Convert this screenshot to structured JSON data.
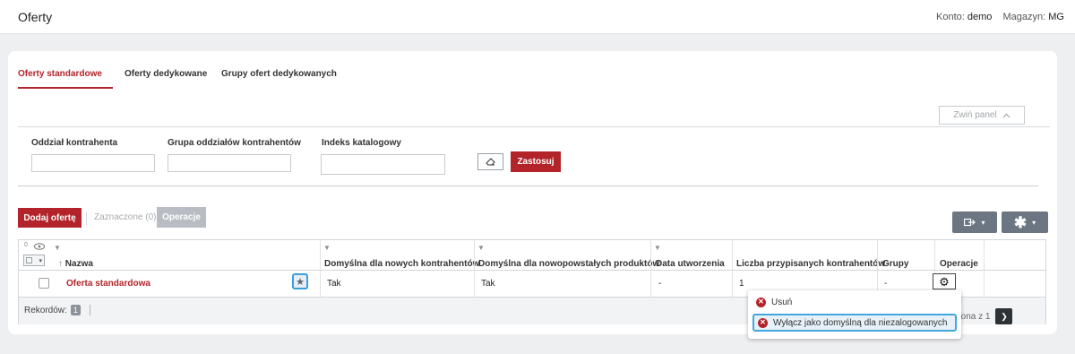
{
  "header": {
    "title": "Oferty",
    "account_label": "Konto:",
    "account_value": "demo",
    "warehouse_label": "Magazyn:",
    "warehouse_value": "MG"
  },
  "tabs": [
    {
      "label": "Oferty standardowe",
      "active": true
    },
    {
      "label": "Oferty dedykowane",
      "active": false
    },
    {
      "label": "Grupy ofert dedykowanych",
      "active": false
    }
  ],
  "panel": {
    "collapse_label": "Zwiń panel",
    "collapse_icon": "chevron-up-icon"
  },
  "filters": [
    {
      "label": "Oddział kontrahenta",
      "value": ""
    },
    {
      "label": "Grupa oddziałów kontrahentów",
      "value": ""
    },
    {
      "label": "Indeks katalogowy",
      "value": ""
    }
  ],
  "filter_actions": {
    "clear_icon": "eraser-icon",
    "apply_label": "Zastosuj"
  },
  "toolbar": {
    "add_label": "Dodaj ofertę",
    "selected_label": "Zaznaczone (0)",
    "operations_label": "Operacje",
    "export_icon": "export-icon",
    "tools_icon": "asterisk-icon"
  },
  "grid": {
    "visible_count": "0",
    "columns": [
      {
        "label": "Nazwa",
        "sort": "asc",
        "filter": false
      },
      {
        "label": "Domyślna dla nowych kontrahentów",
        "filter": true
      },
      {
        "label": "Domyślna dla nowopowstałych produktów",
        "filter": true
      },
      {
        "label": "Data utworzenia",
        "filter": true
      },
      {
        "label": "Liczba przypisanych kontrahentów",
        "filter": false
      },
      {
        "label": "Grupy",
        "filter": false
      },
      {
        "label": "Operacje",
        "filter": false
      }
    ],
    "rows": [
      {
        "name": "Oferta standardowa",
        "default_new_contractors": "Tak",
        "default_new_products": "Tak",
        "created": "-",
        "contractors_count": "1",
        "groups": "-"
      }
    ],
    "footer": {
      "records_label": "Rekordów:",
      "records_count": "1",
      "page_current": "1",
      "page_label": "strona z 1"
    }
  },
  "context_menu": {
    "items": [
      {
        "label": "Usuń",
        "icon": "x-circle-icon",
        "highlighted": false
      },
      {
        "label": "Wyłącz jako domyślną dla niezalogowanych",
        "icon": "x-circle-icon",
        "highlighted": true
      }
    ]
  },
  "colors": {
    "accent": "#b3232a",
    "highlight": "#3b9fd9",
    "dark_button": "#6b7682"
  }
}
